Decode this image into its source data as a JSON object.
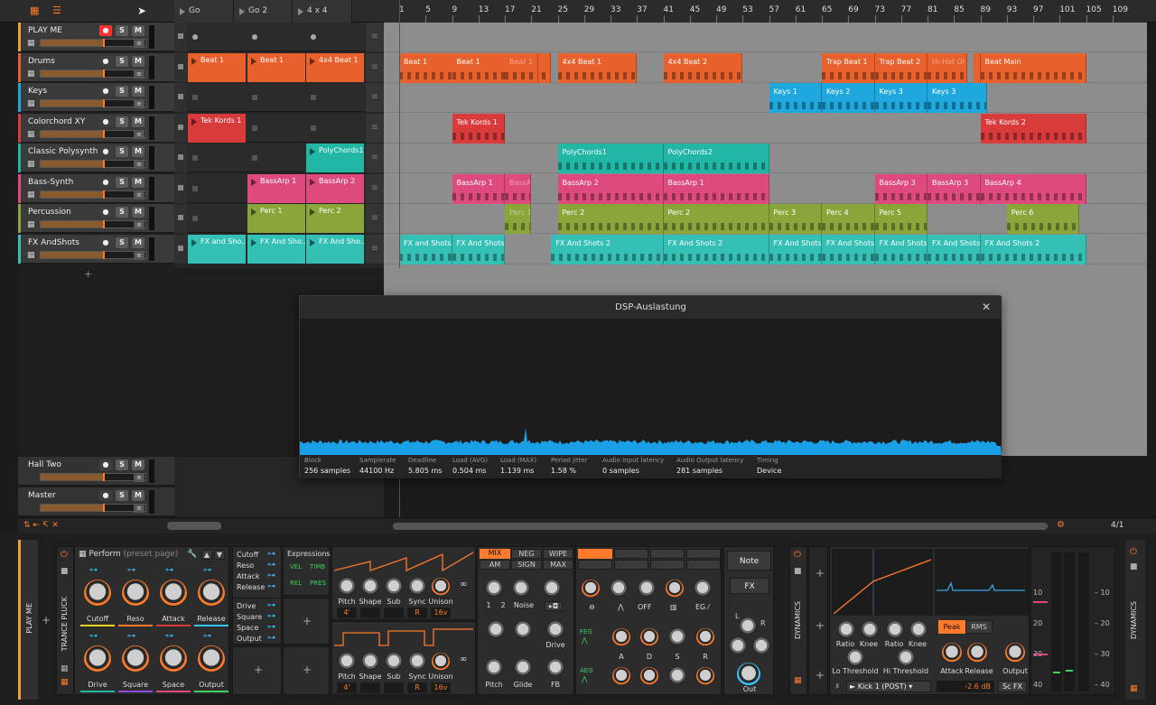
{
  "scenes": [
    "Go",
    "Go 2",
    "4 x 4"
  ],
  "ruler": [
    "1",
    "5",
    "9",
    "13",
    "17",
    "21",
    "25",
    "29",
    "33",
    "37",
    "41",
    "45",
    "49",
    "53",
    "57",
    "61",
    "65",
    "69",
    "73",
    "77",
    "81",
    "85",
    "89",
    "93",
    "97",
    "101",
    "105",
    "109"
  ],
  "tracks": [
    {
      "name": "PLAY ME",
      "color": "#f0a030"
    },
    {
      "name": "Drums",
      "color": "#e8602c"
    },
    {
      "name": "Keys",
      "color": "#1ea8dd"
    },
    {
      "name": "Colorchord XY",
      "color": "#d93a3a"
    },
    {
      "name": "Classic Polysynth",
      "color": "#21b7a4"
    },
    {
      "name": "Bass-Synth",
      "color": "#de4a7e"
    },
    {
      "name": "Percussion",
      "color": "#8aa63a"
    },
    {
      "name": "FX AndShots",
      "color": "#35c0b5"
    }
  ],
  "track_buttons": {
    "s": "S",
    "m": "M"
  },
  "launcher": [
    [],
    [
      "Beat 1",
      "Beat 1",
      "4x4 Beat 1"
    ],
    [],
    [
      "Tek Kords 1"
    ],
    [
      "",
      "",
      "PolyChords1"
    ],
    [
      "",
      "BassArp 1",
      "BassArp 2"
    ],
    [
      "",
      "Perc 1",
      "Perc 2"
    ],
    [
      "FX and Sho...",
      "FX And Sho...",
      "FX And Sho..."
    ]
  ],
  "arranger_clips": {
    "drums": [
      "Beat 1",
      "Beat 1",
      "Beat 1",
      "4x4 Beat 1",
      "4x4 Beat 2",
      "Trap Beat 1",
      "Trap Beat 2",
      "Hi-Hat Oi",
      "Beat Main"
    ],
    "keys": [
      "Keys 1",
      "Keys 2",
      "Keys 3",
      "Keys 3"
    ],
    "colorchord": [
      "Tek Kords 1",
      "Tek Kords 2"
    ],
    "poly": [
      "PolyChords1",
      "PolyChords2"
    ],
    "bass": [
      "BassArp 1",
      "BassArp 1",
      "BassArp 2",
      "BassArp 1",
      "BassArp 3",
      "BassArp 3",
      "BassArp 4"
    ],
    "perc": [
      "Perc 1",
      "Perc 2",
      "Perc 2",
      "Perc 3",
      "Perc 4",
      "Perc 5",
      "Perc 6"
    ],
    "fx": [
      "FX and Shots",
      "FX And Shots",
      "FX And Shots 2",
      "FX And Shots 2",
      "FX And Shots",
      "FX And Shots",
      "FX And Shots",
      "FX And Shots",
      "FX And Shots 2"
    ]
  },
  "bottom_tracks": [
    "Hall Two",
    "Master"
  ],
  "dsp": {
    "title": "DSP-Auslastung",
    "stats": [
      {
        "label": "Block",
        "value": "256 samples"
      },
      {
        "label": "Samplerate",
        "value": "44100 Hz"
      },
      {
        "label": "Deadline",
        "value": "5.805 ms"
      },
      {
        "label": "Load (AVG)",
        "value": "0.504 ms"
      },
      {
        "label": "Load (MAX)",
        "value": "1.139 ms"
      },
      {
        "label": "Period jitter",
        "value": "1.58 %"
      },
      {
        "label": "Audio Input latency",
        "value": "0 samples"
      },
      {
        "label": "Audio Output latency",
        "value": "281 samples"
      },
      {
        "label": "Timing",
        "value": "Device"
      }
    ]
  },
  "transport": {
    "zoom": "4/1"
  },
  "device": {
    "side_left": "PLAY ME",
    "instrument": "TRANCE PLUCK",
    "preset": "Perform",
    "preset_sub": "(preset page)",
    "macros": [
      "Cutoff",
      "Reso",
      "Attack",
      "Release",
      "Drive",
      "Square",
      "Space",
      "Output"
    ],
    "macro_colors": [
      "#f0d020",
      "#ff7a2a",
      "#d93a3a",
      "#35c6ff",
      "#21b7a4",
      "#8a4adf",
      "#de4a7e",
      "#40d060"
    ],
    "mod_list_a": [
      "Cutoff",
      "Reso",
      "Attack",
      "Release"
    ],
    "mod_list_b": [
      "Drive",
      "Square",
      "Space",
      "Output"
    ],
    "expressions": {
      "title": "Expressions",
      "items": [
        "VEL",
        "TIMB",
        "REL",
        "PRES"
      ]
    },
    "osc_knobs": [
      "Pitch",
      "Shape",
      "Sub",
      "Sync",
      "Unison"
    ],
    "osc_values": [
      "4'",
      "",
      "",
      "R",
      "16v"
    ],
    "mix_tabs": [
      "MIX",
      "NEG",
      "WIPE",
      "AM",
      "SIGN",
      "MAX"
    ],
    "mix_knobs": [
      "1",
      "2",
      "Noise"
    ],
    "drive_label": "Drive",
    "pitch_row": [
      "Pitch",
      "Glide",
      "FB"
    ],
    "filter_off": "OFF",
    "env_labels": [
      "A",
      "D",
      "S",
      "R"
    ],
    "env_names": [
      "FEG",
      "AEG"
    ],
    "note_label": "Note",
    "fx_label": "FX",
    "out_label": "Out",
    "lr": [
      "L",
      "R"
    ],
    "dynamics_title": "DYNAMICS",
    "dyn_knobs": [
      "Ratio",
      "Knee",
      "Ratio",
      "Knee"
    ],
    "thresholds": [
      "Lo Threshold",
      "Hi Threshold"
    ],
    "peak_rms": [
      "Peak",
      "RMS"
    ],
    "dyn_lower": [
      "Attack",
      "Release",
      "Output"
    ],
    "sidechain": "Kick 1 (POST)",
    "gain": "-2.6 dB",
    "scfx": "Sc FX",
    "meter_scale": [
      "10",
      "20",
      "30",
      "40"
    ]
  }
}
